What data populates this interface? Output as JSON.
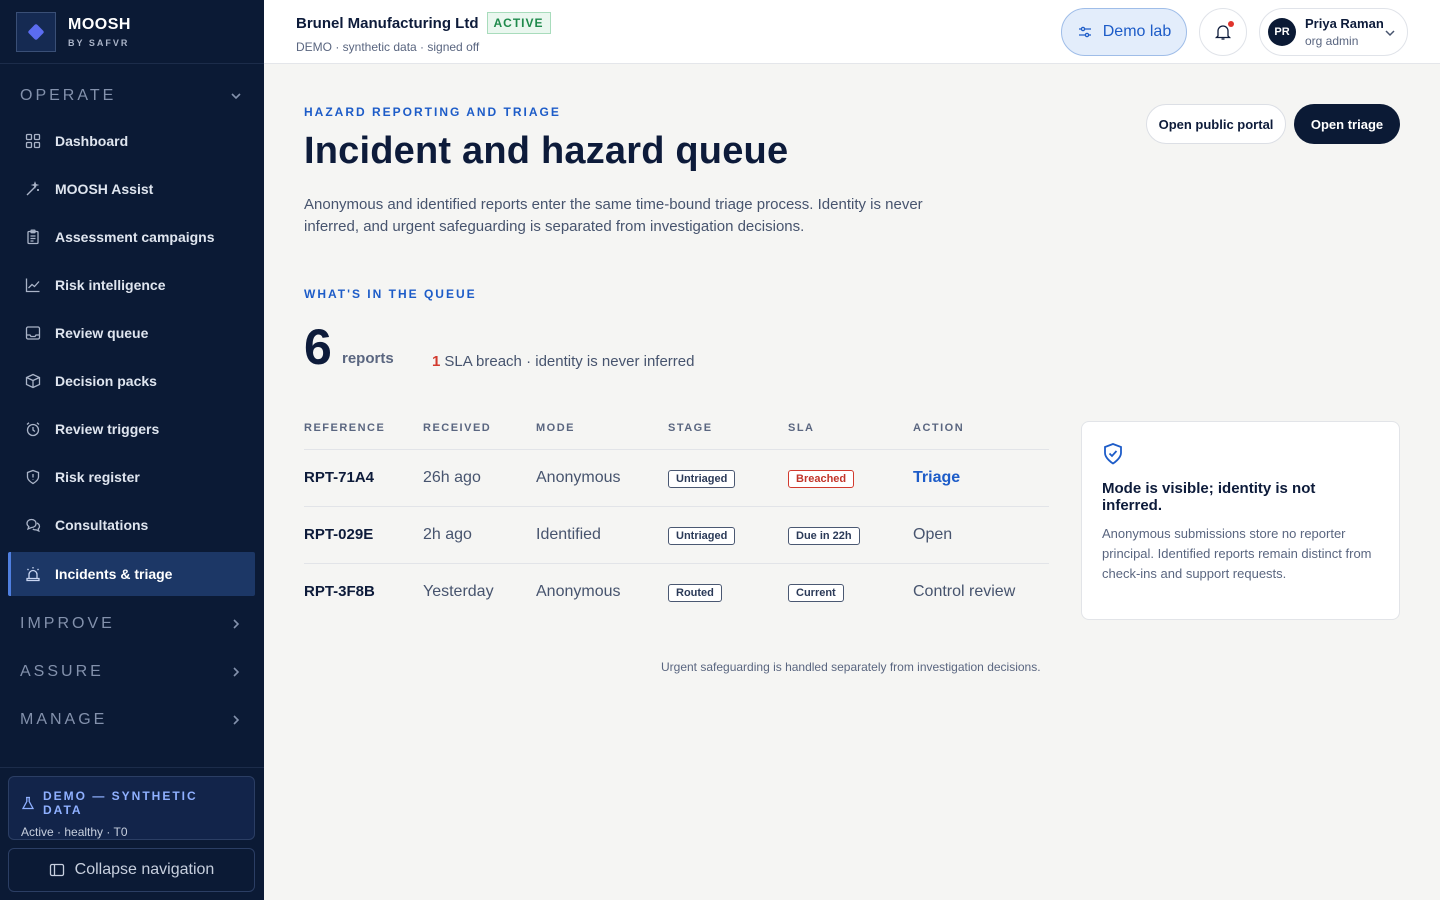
{
  "brand": {
    "name": "MOOSH",
    "sub": "BY SAFVR"
  },
  "sidebar": {
    "sections": {
      "operate": "OPERATE",
      "improve": "IMPROVE",
      "assure": "ASSURE",
      "manage": "MANAGE"
    },
    "items": [
      {
        "label": "Dashboard",
        "icon": "grid-icon"
      },
      {
        "label": "MOOSH Assist",
        "icon": "wand-icon"
      },
      {
        "label": "Assessment campaigns",
        "icon": "clipboard-icon"
      },
      {
        "label": "Risk intelligence",
        "icon": "chart-line-icon"
      },
      {
        "label": "Review queue",
        "icon": "inbox-icon"
      },
      {
        "label": "Decision packs",
        "icon": "package-icon"
      },
      {
        "label": "Review triggers",
        "icon": "alarm-clock-icon"
      },
      {
        "label": "Risk register",
        "icon": "shield-alert-icon"
      },
      {
        "label": "Consultations",
        "icon": "chat-bubbles-icon"
      },
      {
        "label": "Incidents & triage",
        "icon": "siren-icon",
        "active": true
      }
    ],
    "demo": {
      "title": "DEMO — SYNTHETIC DATA",
      "status": "Active · healthy · T0"
    },
    "collapse_label": "Collapse navigation"
  },
  "topbar": {
    "org_name": "Brunel Manufacturing Ltd",
    "org_status": "ACTIVE",
    "org_sub": "DEMO · synthetic data · signed off",
    "demo_lab": "Demo lab",
    "user": {
      "initials": "PR",
      "name": "Priya Raman",
      "role": "org admin"
    }
  },
  "page": {
    "eyebrow": "HAZARD REPORTING AND TRIAGE",
    "title": "Incident and hazard queue",
    "description": "Anonymous and identified reports enter the same time-bound triage process. Identity is never inferred, and urgent safeguarding is separated from investigation decisions.",
    "btn_portal": "Open public portal",
    "btn_triage": "Open triage"
  },
  "queue": {
    "eyebrow": "WHAT'S IN THE QUEUE",
    "count": "6",
    "count_label": "reports",
    "breach_count": "1",
    "note": "SLA breach · identity is never inferred",
    "columns": [
      "REFERENCE",
      "RECEIVED",
      "MODE",
      "STAGE",
      "SLA",
      "ACTION"
    ],
    "rows": [
      {
        "ref": "RPT-71A4",
        "received": "26h ago",
        "mode": "Anonymous",
        "stage": "Untriaged",
        "sla": "Breached",
        "action": "Triage"
      },
      {
        "ref": "RPT-029E",
        "received": "2h ago",
        "mode": "Identified",
        "stage": "Untriaged",
        "sla": "Due in 22h",
        "action": "Open"
      },
      {
        "ref": "RPT-3F8B",
        "received": "Yesterday",
        "mode": "Anonymous",
        "stage": "Routed",
        "sla": "Current",
        "action": "Control review"
      }
    ],
    "footnote": "Urgent safeguarding is handled separately from investigation decisions."
  },
  "info_card": {
    "icon": "shield-check-icon",
    "title": "Mode is visible; identity is not inferred.",
    "body": "Anonymous submissions store no reporter principal. Identified reports remain distinct from check-ins and support requests."
  },
  "colors": {
    "sidebar_bg": "#0b1a35",
    "accent": "#1d5cc8",
    "breach": "#d23a2e",
    "active_green": "#1f8a4c"
  }
}
